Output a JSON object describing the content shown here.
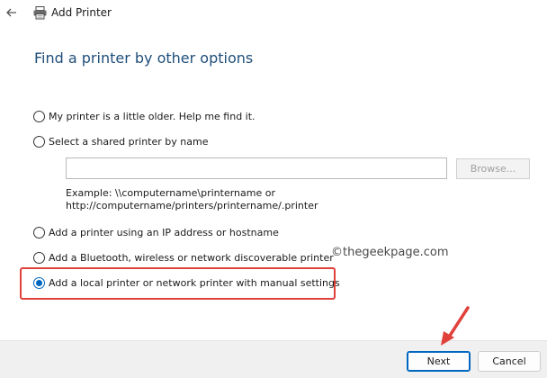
{
  "window": {
    "title": "Add Printer"
  },
  "heading": "Find a printer by other options",
  "options": [
    {
      "label": "My printer is a little older. Help me find it.",
      "checked": false
    },
    {
      "label": "Select a shared printer by name",
      "checked": false
    },
    {
      "label": "Add a printer using an IP address or hostname",
      "checked": false
    },
    {
      "label": "Add a Bluetooth, wireless or network discoverable printer",
      "checked": false
    },
    {
      "label": "Add a local printer or network printer with manual settings",
      "checked": true
    }
  ],
  "shared_printer": {
    "value": "",
    "browse_label": "Browse...",
    "example_line1": "Example: \\\\computername\\printername or",
    "example_line2": "http://computername/printers/printername/.printer"
  },
  "watermark": "©thegeekpage.com",
  "buttons": {
    "next": "Next",
    "cancel": "Cancel"
  },
  "colors": {
    "accent": "#0067c0",
    "heading": "#1f4e79",
    "annotation": "#e0413b",
    "footer": "#f0f0f0"
  },
  "icons": [
    "back-arrow-icon",
    "printer-icon",
    "radio-icon",
    "annotation-arrow-icon"
  ]
}
